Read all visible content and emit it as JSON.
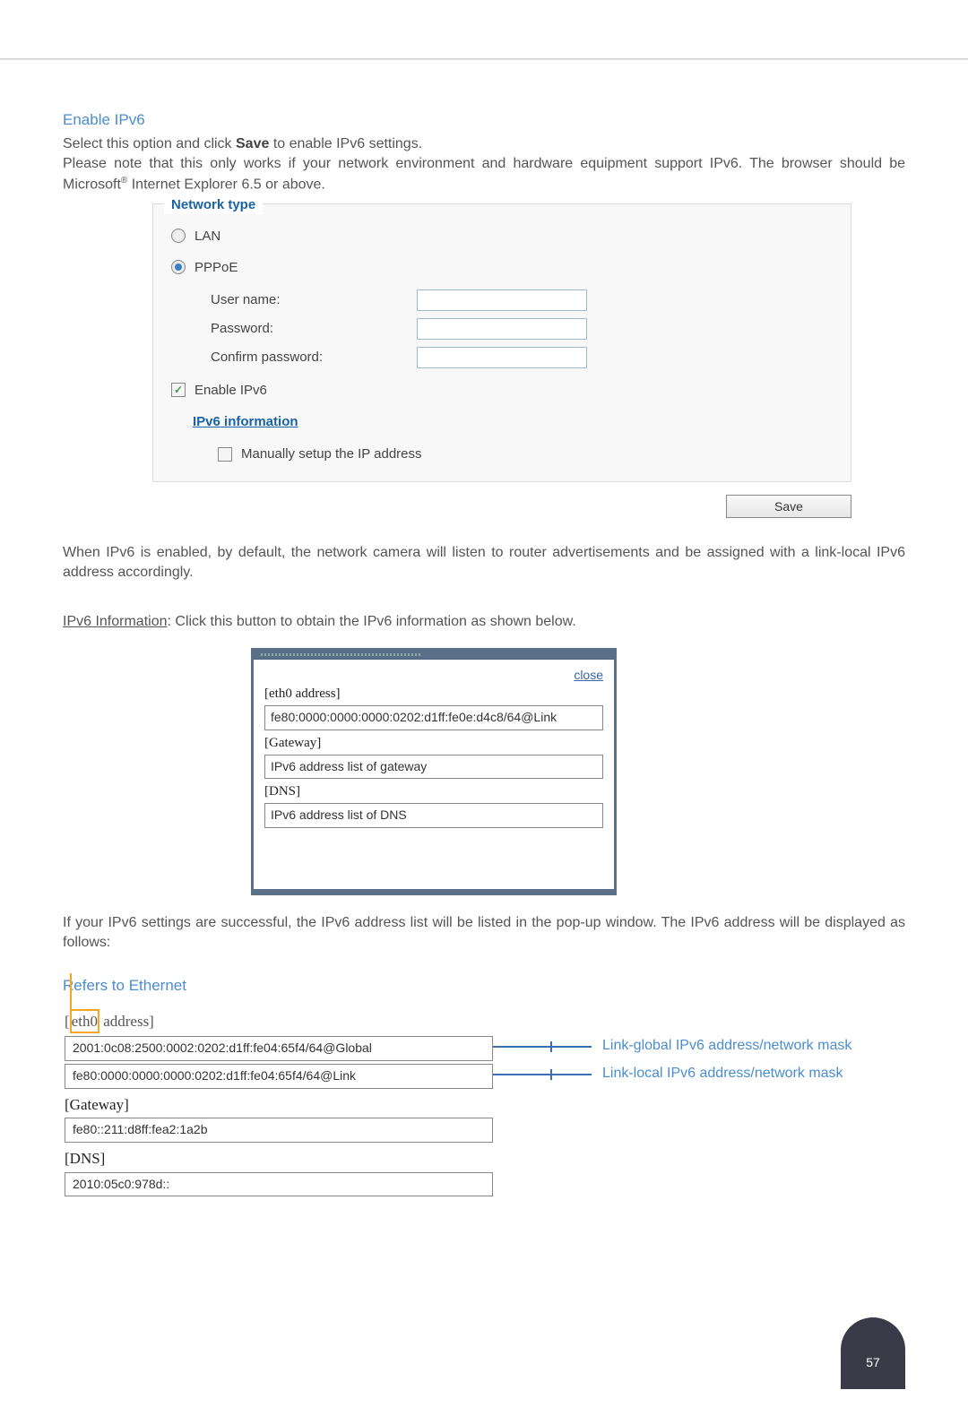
{
  "headings": {
    "enable_ipv6": "Enable IPv6",
    "refers_ethernet": "Refers to Ethernet"
  },
  "paragraphs": {
    "intro_1": "Select this option and click ",
    "intro_save": "Save",
    "intro_2": " to enable IPv6 settings.",
    "intro_3_a": "Please note that this only works if your network environment and hardware equipment support IPv6. The browser should be Microsoft",
    "intro_3_b": " Internet Explorer 6.5 or above.",
    "after_panel": "When IPv6 is enabled, by default, the network camera will listen to router advertisements and be assigned with a link-local IPv6 address accordingly.",
    "ipv6_info_prefix": "IPv6 Information",
    "ipv6_info_rest": ": Click this button to obtain the IPv6 information as shown below.",
    "after_popup": "If your IPv6 settings are successful, the IPv6 address list will be listed in the pop-up window. The IPv6 address will be displayed as follows:"
  },
  "panel": {
    "legend": "Network type",
    "radio_lan": "LAN",
    "radio_pppoe": "PPPoE",
    "fields": {
      "username": "User name:",
      "password": "Password:",
      "confirm": "Confirm password:"
    },
    "enable_ipv6": "Enable IPv6",
    "ipv6_information": "IPv6 information",
    "manual_setup": "Manually setup the IP address",
    "save": "Save"
  },
  "popup": {
    "close": "close",
    "eth0_label": "[eth0 address]",
    "eth0_value": "fe80:0000:0000:0000:0202:d1ff:fe0e:d4c8/64@Link",
    "gateway_label": "[Gateway]",
    "gateway_value": "IPv6 address list of gateway",
    "dns_label": "[DNS]",
    "dns_value": "IPv6 address list of DNS"
  },
  "eth_diagram": {
    "eth0_br_prefix": "[",
    "eth0_br_word": "eth0",
    "eth0_br_rest": " address]",
    "global_addr": "2001:0c08:2500:0002:0202:d1ff:fe04:65f4/64@Global",
    "link_addr": "fe80:0000:0000:0000:0202:d1ff:fe04:65f4/64@Link",
    "gateway_label": "[Gateway]",
    "gateway_value": "fe80::211:d8ff:fea2:1a2b",
    "dns_label": "[DNS]",
    "dns_value": "2010:05c0:978d::",
    "conn_label_global": "Link-global IPv6 address/network mask",
    "conn_label_link": "Link-local IPv6 address/network mask"
  },
  "page_number": "57"
}
